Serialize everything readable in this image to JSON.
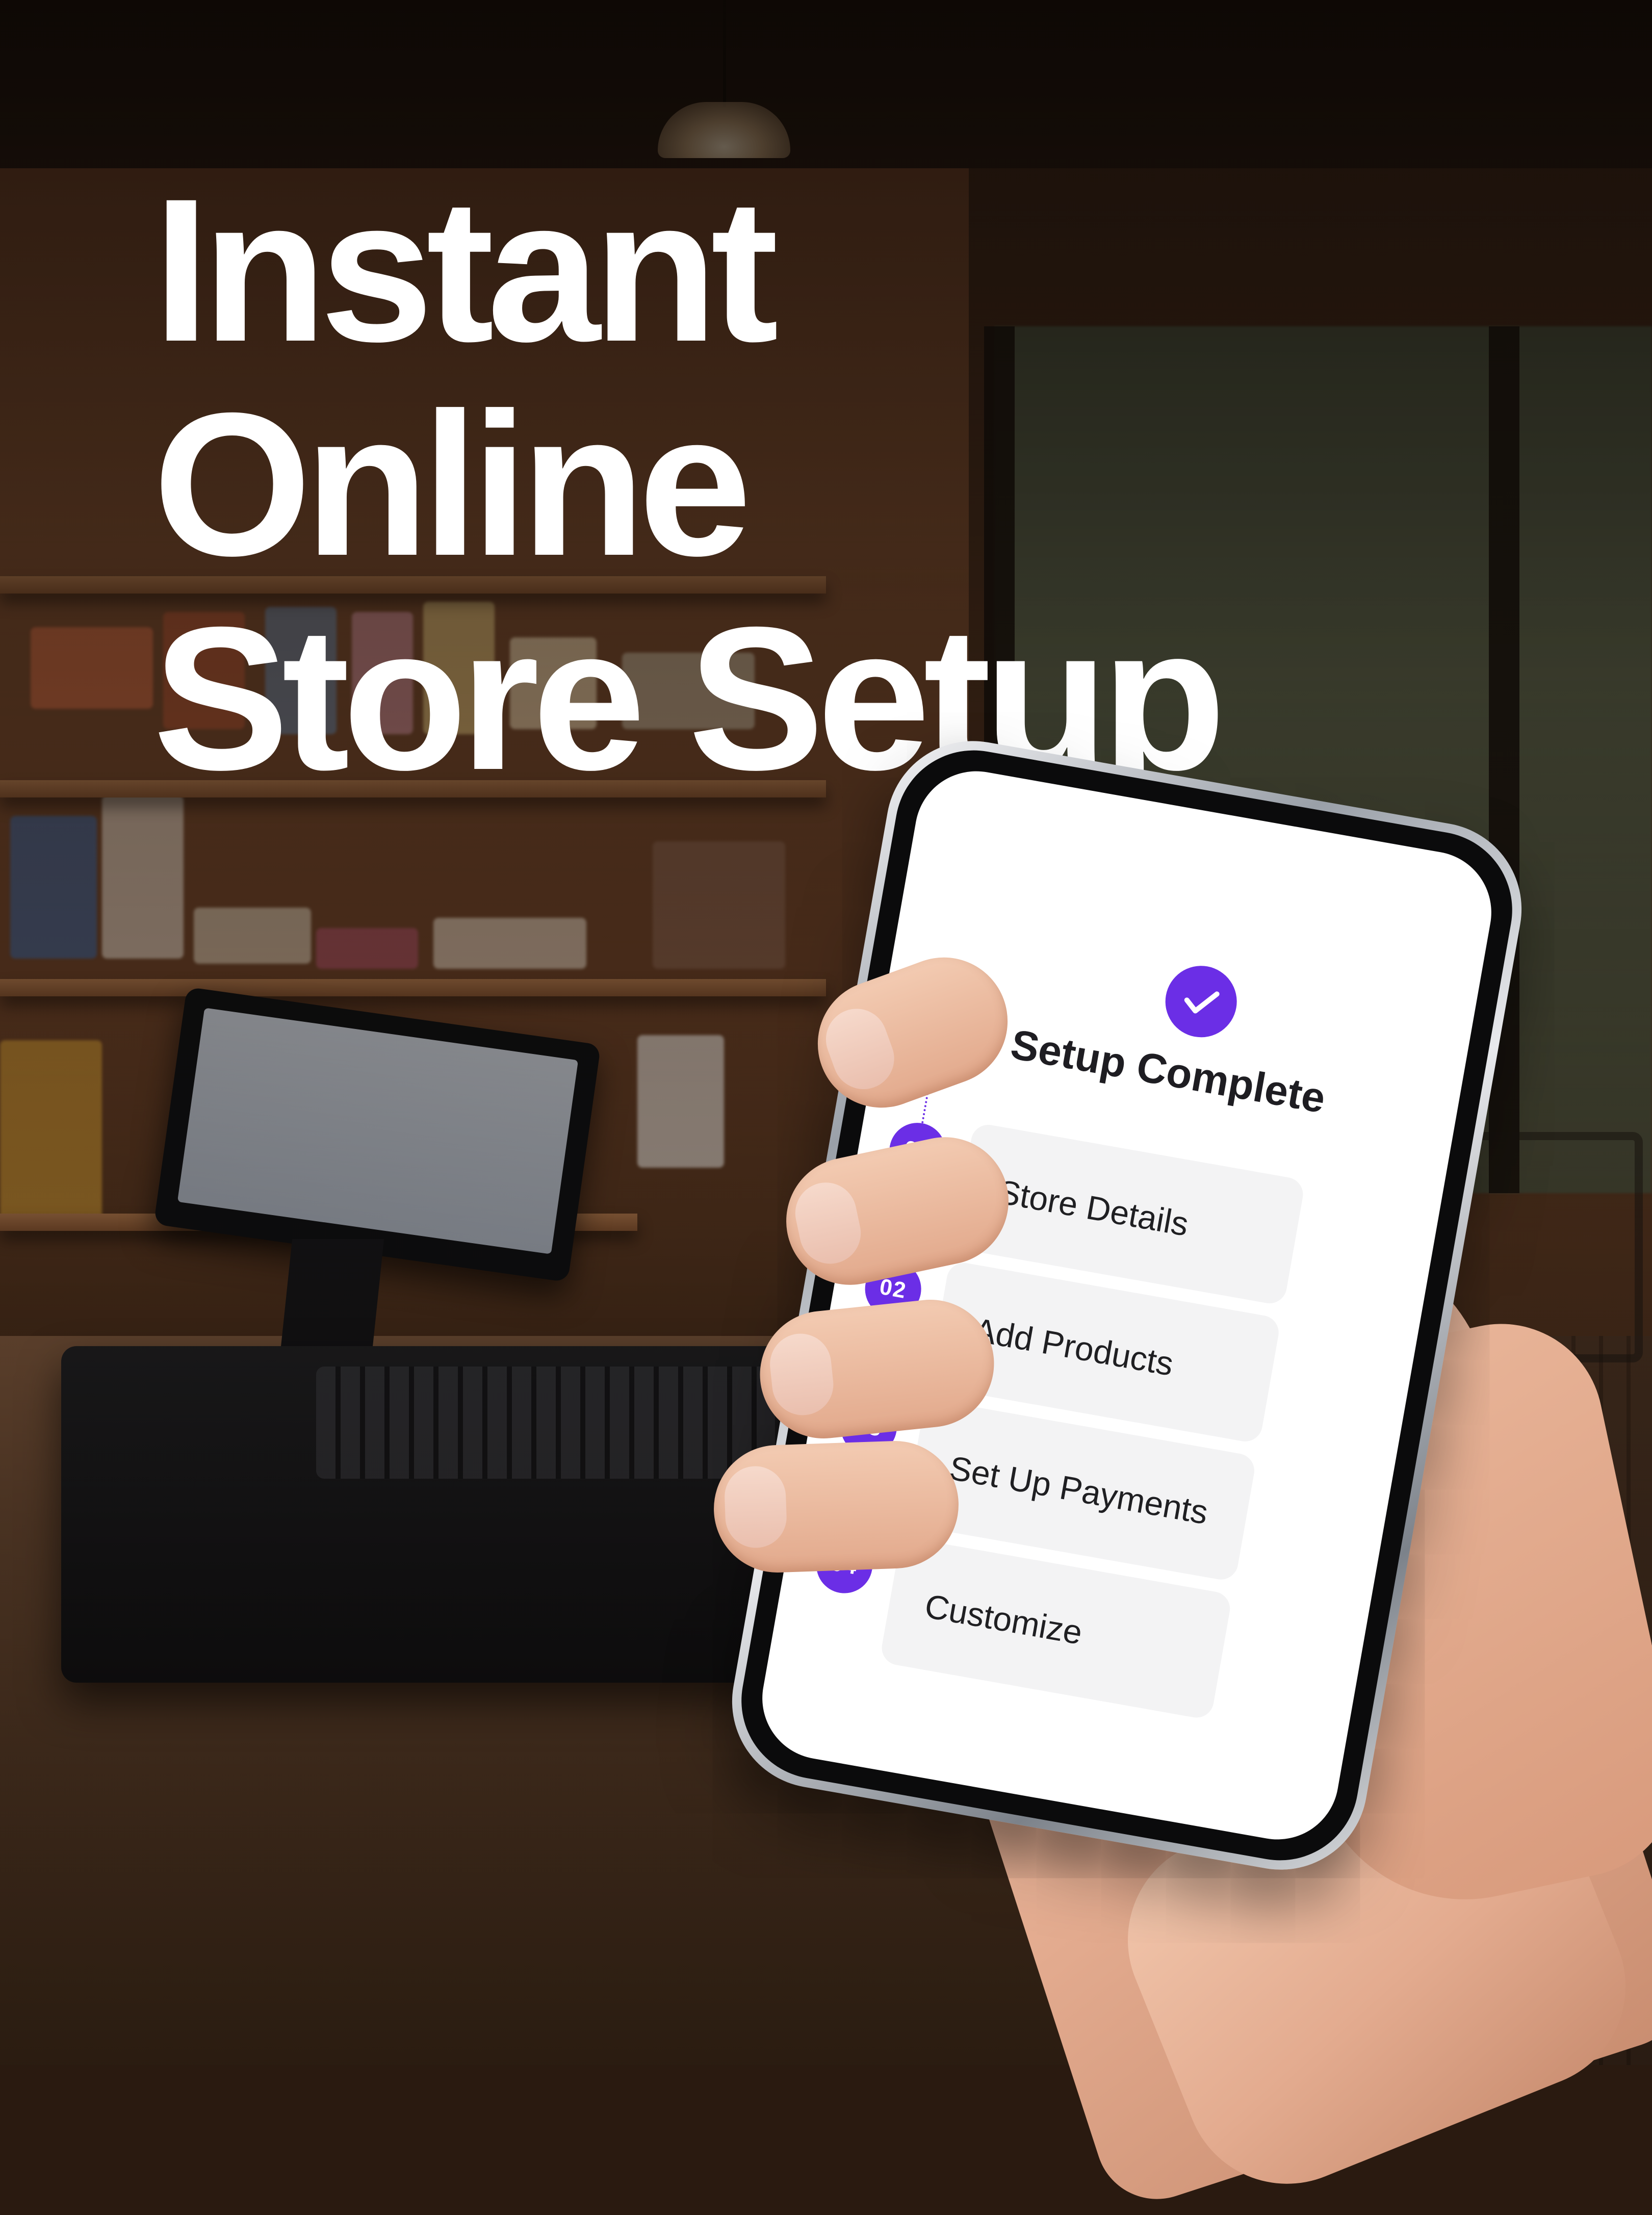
{
  "headline": {
    "line1": "Instant Online",
    "line2": "Store Setup"
  },
  "phone_screen": {
    "status_icon": "check-icon",
    "title": "Setup Complete",
    "accent_color": "#6b2ee6",
    "steps": [
      {
        "number": "01",
        "label": "Store Details"
      },
      {
        "number": "02",
        "label": "Add Products"
      },
      {
        "number": "03",
        "label": "Set Up Payments"
      },
      {
        "number": "04",
        "label": "Customize"
      }
    ]
  }
}
